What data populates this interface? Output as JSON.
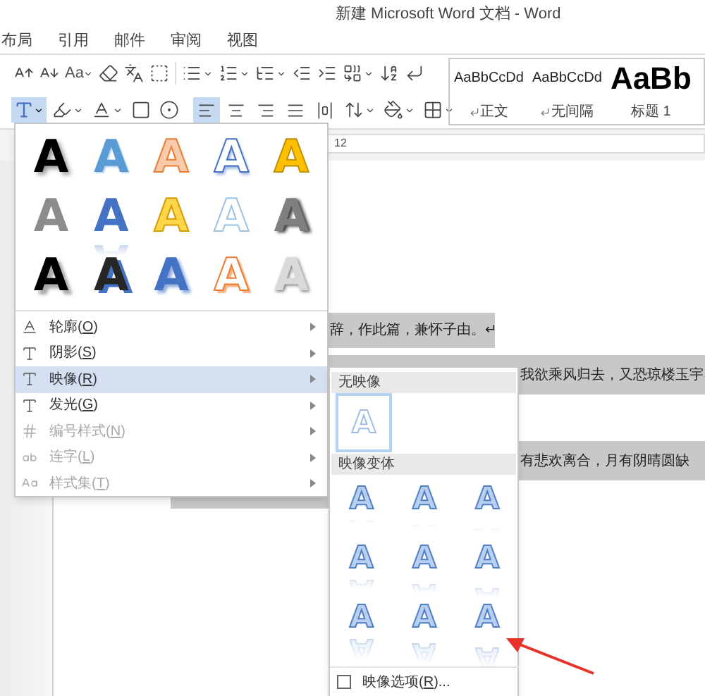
{
  "window": {
    "title": "新建 Microsoft Word 文档 - Word"
  },
  "ribbon_tabs": [
    {
      "label": "布局"
    },
    {
      "label": "引用"
    },
    {
      "label": "邮件"
    },
    {
      "label": "审阅"
    },
    {
      "label": "视图"
    }
  ],
  "font_toolbar": {
    "change_case_label": "Aa",
    "text_effects_button": {
      "expanded": true
    }
  },
  "paragraph_toolbar": {
    "alignment": [
      {
        "kind": "left",
        "selected": true
      },
      {
        "kind": "center",
        "selected": false
      },
      {
        "kind": "right",
        "selected": false
      },
      {
        "kind": "justify",
        "selected": false
      },
      {
        "kind": "distributed",
        "selected": false
      }
    ]
  },
  "styles_gallery": [
    {
      "preview": "AaBbCcDd",
      "name": "正文",
      "kind": "paragraph"
    },
    {
      "preview": "AaBbCcDd",
      "name": "无间隔",
      "kind": "paragraph"
    },
    {
      "preview": "AaBb",
      "name": "标题 1",
      "kind": "heading"
    }
  ],
  "ruler": {
    "label": "12"
  },
  "document": {
    "lines": [
      {
        "text": "辞，作此篇，兼怀子由。↵",
        "kind": "short"
      },
      {
        "text": "我欲乘风归去，又恐琼楼玉宇",
        "kind": "long"
      },
      {
        "text": "有悲欢离合，月有阴晴圆缺",
        "kind": "long"
      }
    ]
  },
  "text_effects_menu": {
    "gallery": [
      {
        "letter": "A",
        "kind": "black-shadow"
      },
      {
        "letter": "A",
        "kind": "blue-gradient"
      },
      {
        "letter": "A",
        "kind": "orange-outline"
      },
      {
        "letter": "A",
        "kind": "blue-outline"
      },
      {
        "letter": "A",
        "kind": "gold-bevel"
      },
      {
        "letter": "A",
        "kind": "gray"
      },
      {
        "letter": "A",
        "kind": "blue-reflection"
      },
      {
        "letter": "A",
        "kind": "yellow-outline"
      },
      {
        "letter": "A",
        "kind": "light-blue-outline"
      },
      {
        "letter": "A",
        "kind": "gray-bevel"
      },
      {
        "letter": "A",
        "kind": "black-thick"
      },
      {
        "letter": "A",
        "kind": "dark-blue-shadow"
      },
      {
        "letter": "A",
        "kind": "blue-shadow"
      },
      {
        "letter": "A",
        "kind": "orange-shadow-outline"
      },
      {
        "letter": "A",
        "kind": "silver"
      }
    ],
    "items": [
      {
        "label": "轮廓(",
        "access_key": "O",
        "label_end": ")",
        "kind": "outline",
        "disabled": false,
        "selected": false
      },
      {
        "label": "阴影(",
        "access_key": "S",
        "label_end": ")",
        "kind": "shadow",
        "disabled": false,
        "selected": false
      },
      {
        "label": "映像(",
        "access_key": "R",
        "label_end": ")",
        "kind": "reflection",
        "disabled": false,
        "selected": true
      },
      {
        "label": "发光(",
        "access_key": "G",
        "label_end": ")",
        "kind": "glow",
        "disabled": false,
        "selected": false
      },
      {
        "label": "编号样式(",
        "access_key": "N",
        "label_end": ")",
        "kind": "numbering",
        "disabled": true,
        "selected": false
      },
      {
        "label": "连字(",
        "access_key": "L",
        "label_end": ")",
        "kind": "ligature",
        "disabled": true,
        "selected": false
      },
      {
        "label": "样式集(",
        "access_key": "T",
        "label_end": ")",
        "kind": "style-set",
        "disabled": true,
        "selected": false
      }
    ]
  },
  "reflection_submenu": {
    "no_reflection_header": "无映像",
    "no_reflection": {
      "letter": "A",
      "selected": true
    },
    "variants_header": "映像变体",
    "variants": [
      {
        "letter": "A",
        "kind": "tight-touching"
      },
      {
        "letter": "A",
        "kind": "tight-4pt"
      },
      {
        "letter": "A",
        "kind": "tight-8pt"
      },
      {
        "letter": "A",
        "kind": "half-touching"
      },
      {
        "letter": "A",
        "kind": "half-4pt"
      },
      {
        "letter": "A",
        "kind": "half-8pt"
      },
      {
        "letter": "A",
        "kind": "full-touching"
      },
      {
        "letter": "A",
        "kind": "full-4pt"
      },
      {
        "letter": "A",
        "kind": "full-8pt"
      }
    ],
    "options": {
      "label": "映像选项(",
      "access_key": "R",
      "label_end": ")...",
      "checked": false
    }
  }
}
